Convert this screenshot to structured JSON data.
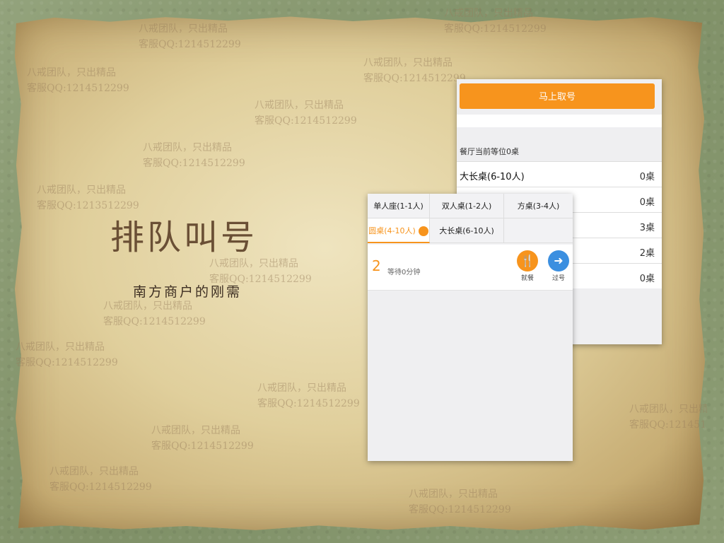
{
  "slide": {
    "title": "排队叫号",
    "subtitle": "南方商户的刚需"
  },
  "watermark": {
    "line1": "八戒团队，只出精品",
    "line2": "客服QQ:1214512299",
    "line2_alt": "客服QQ:1213512299"
  },
  "back_card": {
    "take_number_button": "马上取号",
    "waiting_label": "餐厅当前等位0桌",
    "rows": [
      {
        "name": "大长桌(6-10人)",
        "count": "0桌"
      },
      {
        "name": "",
        "count": "0桌"
      },
      {
        "name": "",
        "count": "3桌"
      },
      {
        "name": "",
        "count": "2桌"
      },
      {
        "name": "",
        "count": "0桌"
      }
    ]
  },
  "front_card": {
    "tabs": [
      {
        "label": "单人座(1-1人)"
      },
      {
        "label": "双人桌(1-2人)"
      },
      {
        "label": "方桌(3-4人)"
      },
      {
        "label": "圆桌(4-10人)"
      },
      {
        "label": "大长桌(6-10人)"
      }
    ],
    "queue": {
      "number": "2",
      "wait_text": "等待0分钟",
      "seat_label": "就餐",
      "pass_label": "过号"
    }
  },
  "colors": {
    "accent": "#f7941d",
    "pass_blue": "#3b8fe0",
    "title_brown": "#6a4f35"
  }
}
